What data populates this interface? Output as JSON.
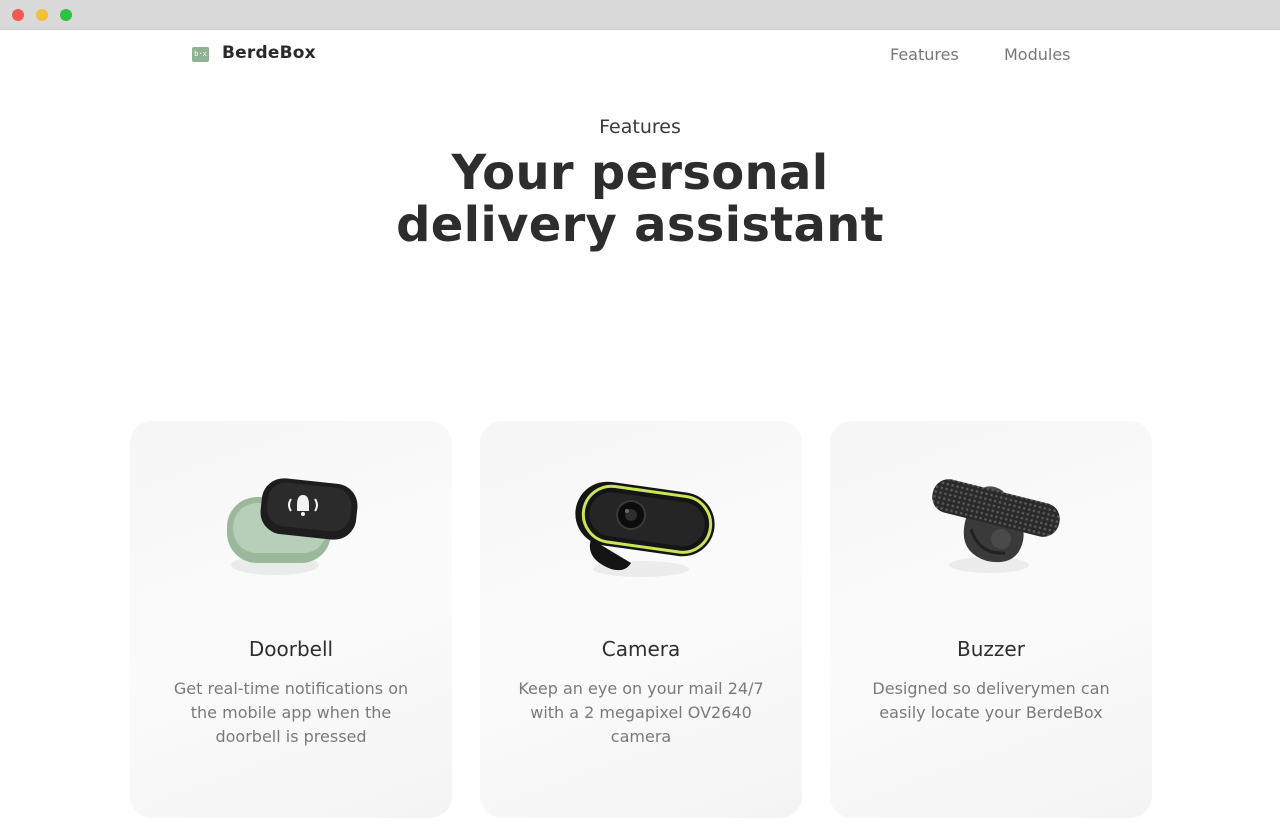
{
  "window": {
    "controls": [
      "close",
      "minimize",
      "maximize"
    ]
  },
  "nav": {
    "brand": "BerdeBox",
    "logo_mark": "b·x",
    "links": [
      {
        "label": "Features"
      },
      {
        "label": "Modules"
      }
    ]
  },
  "hero": {
    "eyebrow": "Features",
    "headline_line1": "Your personal",
    "headline_line2": "delivery assistant"
  },
  "cards": [
    {
      "title": "Doorbell",
      "description": "Get real-time notifications on the mobile app when the doorbell is pressed",
      "image": "doorbell-module-image"
    },
    {
      "title": "Camera",
      "description": "Keep an eye on your mail 24/7 with a 2 megapixel OV2640 camera",
      "image": "camera-module-image"
    },
    {
      "title": "Buzzer",
      "description": "Designed so deliverymen can easily locate your BerdeBox",
      "image": "buzzer-module-image"
    }
  ],
  "colors": {
    "brand_green": "#8fb392",
    "text_dark": "#2d2d2d",
    "text_muted": "#7a7a7a",
    "card_bg": "#f7f7f7",
    "camera_accent": "#c8e65a"
  }
}
